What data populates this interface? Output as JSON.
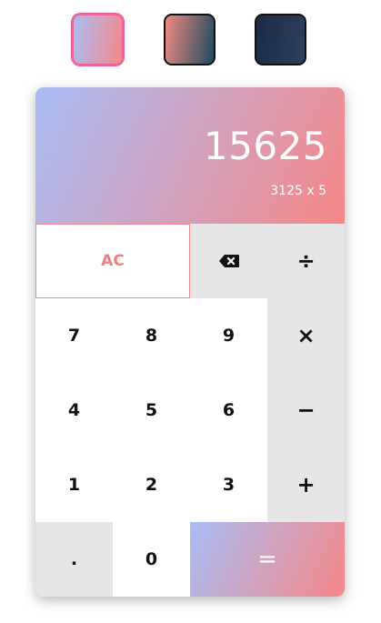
{
  "theme": {
    "gradient_start": "#a9bdf5",
    "gradient_end": "#f78787",
    "swatches": [
      {
        "name": "pastel",
        "from": "#a9bdf5",
        "to": "#f78787",
        "selected": true
      },
      {
        "name": "coral-teal",
        "from": "#f08a80",
        "to": "#1d4a60",
        "selected": false
      },
      {
        "name": "navy",
        "from": "#1d2b45",
        "to": "#2d3f5e",
        "selected": false
      }
    ]
  },
  "display": {
    "result": "15625",
    "expression": "3125 x 5"
  },
  "keys": {
    "clear": "AC",
    "divide": "÷",
    "seven": "7",
    "eight": "8",
    "nine": "9",
    "multiply": "×",
    "four": "4",
    "five": "5",
    "six": "6",
    "subtract": "−",
    "one": "1",
    "two": "2",
    "three": "3",
    "add": "+",
    "decimal": ".",
    "zero": "0",
    "equals": "="
  },
  "icons": {
    "backspace": "backspace-icon"
  }
}
